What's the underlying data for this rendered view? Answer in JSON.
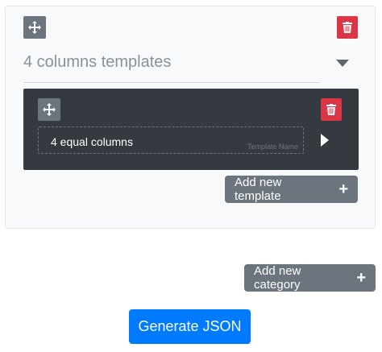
{
  "category": {
    "title": "4 columns templates",
    "move_icon": "arrows-move-icon",
    "delete_icon": "trash-icon",
    "collapse_icon": "caret-down-icon"
  },
  "template": {
    "name_value": "4 equal columns",
    "name_label": "Template Name",
    "move_icon": "arrows-move-icon",
    "delete_icon": "trash-icon",
    "expand_icon": "caret-right-icon"
  },
  "buttons": {
    "add_template": "Add new template",
    "add_category": "Add new category",
    "generate_json": "Generate JSON",
    "plus_symbol": "+"
  },
  "colors": {
    "secondary": "#6c757d",
    "danger": "#dc3545",
    "primary": "#007bff",
    "dark": "#343a40"
  }
}
